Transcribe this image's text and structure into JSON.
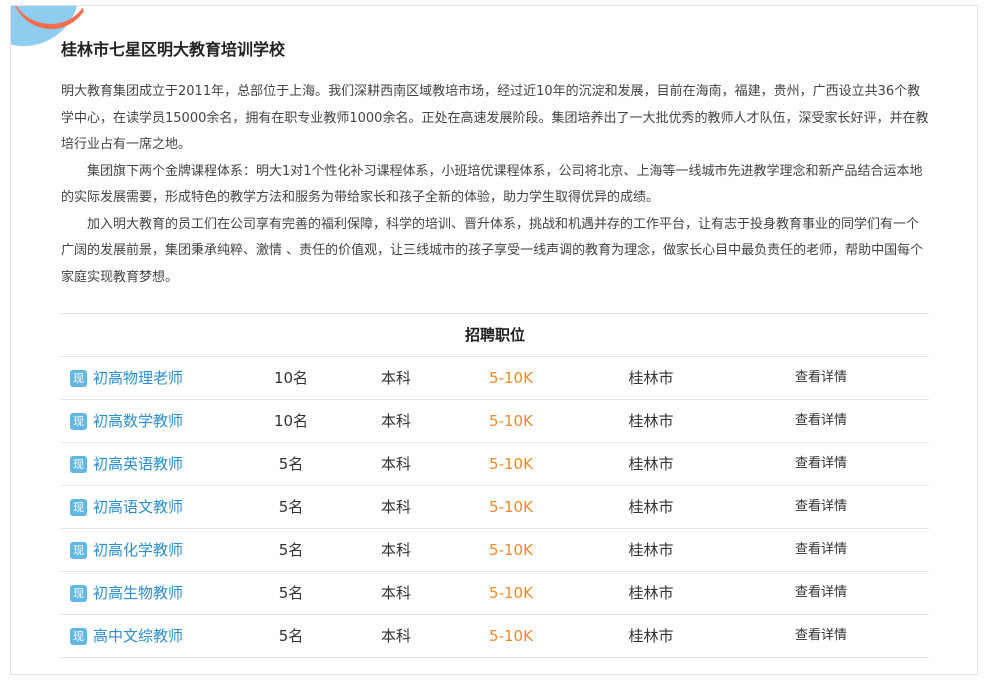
{
  "school": {
    "title": "桂林市七星区明大教育培训学校"
  },
  "intro": {
    "paragraphs": [
      "明大教育集团成立于2011年，总部位于上海。我们深耕西南区域教培市场，经过近10年的沉淀和发展，目前在海南，福建，贵州，广西设立共36个教学中心，在读学员15000余名，拥有在职专业教师1000余名。正处在高速发展阶段。集团培养出了一大批优秀的教师人才队伍，深受家长好评，并在教培行业占有一席之地。",
      "集团旗下两个金牌课程体系：明大1对1个性化补习课程体系，小班培优课程体系，公司将北京、上海等一线城市先进教学理念和新产品结合运本地的实际发展需要，形成特色的教学方法和服务为带给家长和孩子全新的体验，助力学生取得优异的成绩。",
      "加入明大教育的员工们在公司享有完善的福利保障，科学的培训、晋升体系，挑战和机遇并存的工作平台，让有志于投身教育事业的同学们有一个广阔的发展前景，集团秉承纯粹、激情 、责任的价值观，让三线城市的孩子享受一线声调的教育为理念，做家长心目中最负责任的老师，帮助中国每个家庭实现教育梦想。"
    ]
  },
  "jobs": {
    "header": "招聘职位",
    "rows": [
      {
        "badge": "现",
        "title": "初高物理老师",
        "count": "10名",
        "education": "本科",
        "salary": "5-10K",
        "city": "桂林市",
        "detail": "查看详情"
      },
      {
        "badge": "现",
        "title": "初高数学教师",
        "count": "10名",
        "education": "本科",
        "salary": "5-10K",
        "city": "桂林市",
        "detail": "查看详情"
      },
      {
        "badge": "现",
        "title": "初高英语教师",
        "count": "5名",
        "education": "本科",
        "salary": "5-10K",
        "city": "桂林市",
        "detail": "查看详情"
      },
      {
        "badge": "现",
        "title": "初高语文教师",
        "count": "5名",
        "education": "本科",
        "salary": "5-10K",
        "city": "桂林市",
        "detail": "查看详情"
      },
      {
        "badge": "现",
        "title": "初高化学教师",
        "count": "5名",
        "education": "本科",
        "salary": "5-10K",
        "city": "桂林市",
        "detail": "查看详情"
      },
      {
        "badge": "现",
        "title": "初高生物教师",
        "count": "5名",
        "education": "本科",
        "salary": "5-10K",
        "city": "桂林市",
        "detail": "查看详情"
      },
      {
        "badge": "现",
        "title": "高中文综教师",
        "count": "5名",
        "education": "本科",
        "salary": "5-10K",
        "city": "桂林市",
        "detail": "查看详情"
      }
    ]
  },
  "colors": {
    "accent_blue": "#2b8fd0",
    "badge_blue": "#62b8e2",
    "salary_orange": "#f08a2a",
    "deco_red": "#f46d4d"
  }
}
